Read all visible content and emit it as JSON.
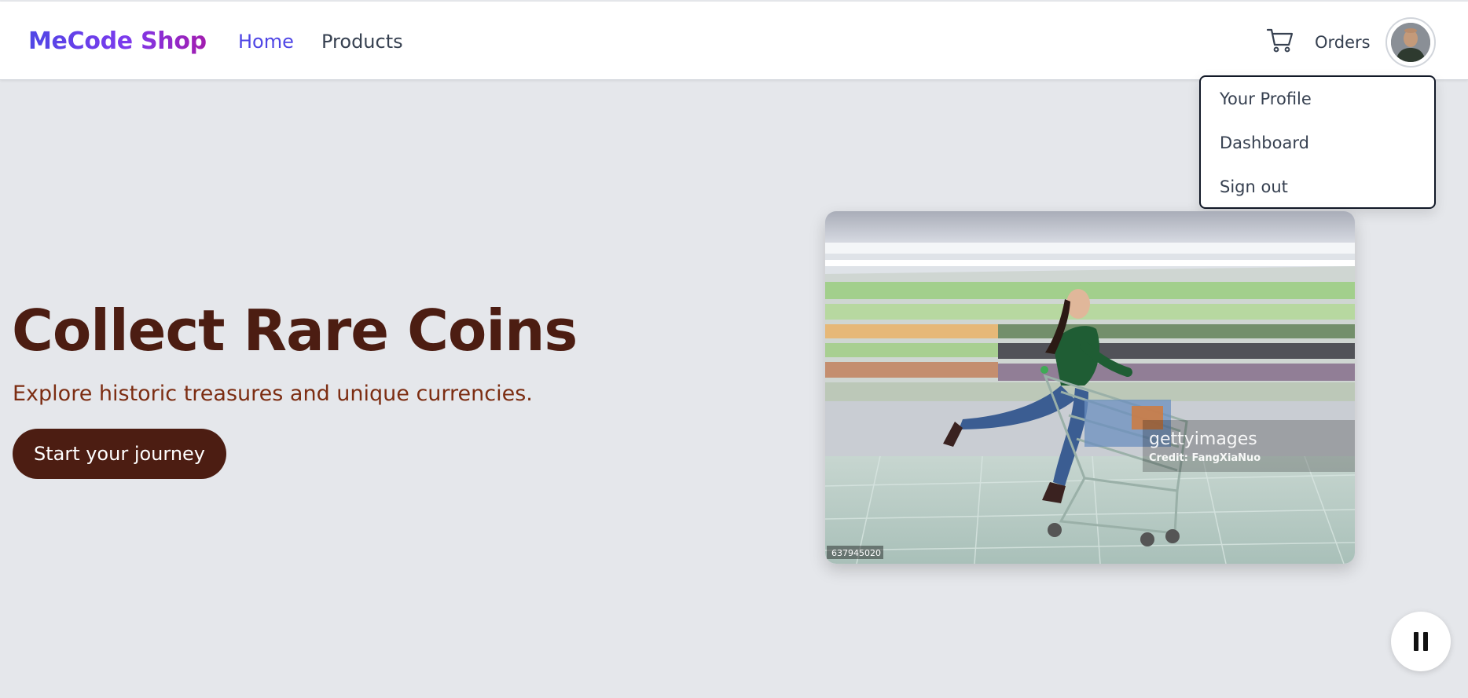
{
  "header": {
    "logo": "MeCode Shop",
    "nav": {
      "home": "Home",
      "products": "Products"
    },
    "cart_icon": "shopping-cart-icon",
    "orders": "Orders",
    "avatar": "user-avatar"
  },
  "user_menu": {
    "items": [
      "Your Profile",
      "Dashboard",
      "Sign out"
    ]
  },
  "hero": {
    "title": "Collect Rare Coins",
    "subtitle": "Explore historic treasures and unique currencies.",
    "cta": "Start your journey",
    "image": {
      "watermark_brand": "gettyimages",
      "watermark_credit": "Credit: FangXiaNuo",
      "image_id": "637945020"
    }
  },
  "carousel": {
    "control_icon": "pause-icon"
  },
  "colors": {
    "brand_start": "#4f46e5",
    "brand_end": "#a21caf",
    "active_nav": "#4f46e5",
    "hero_dark": "#4c1d12",
    "hero_text": "#7c2d12",
    "page_bg": "#e5e7eb"
  }
}
